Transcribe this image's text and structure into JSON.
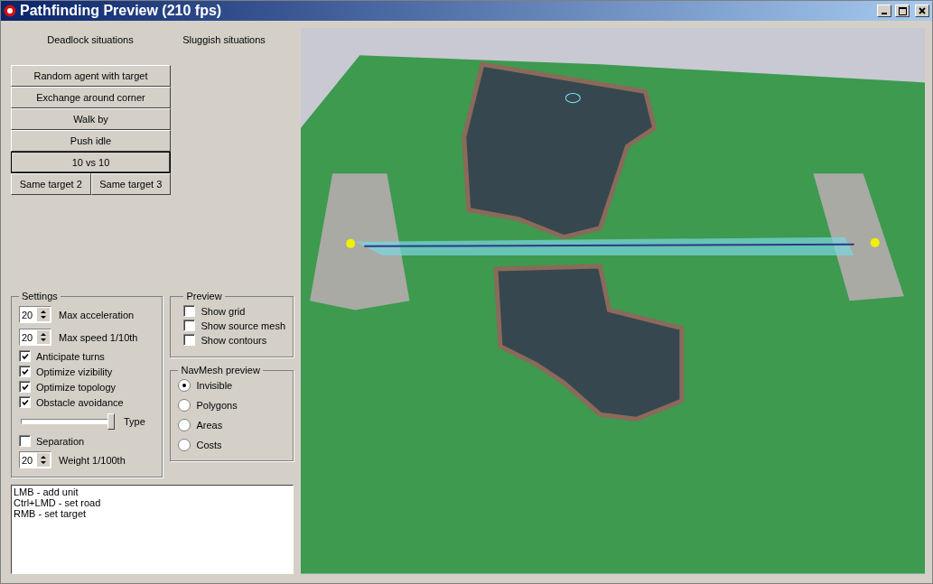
{
  "window": {
    "title": "Pathfinding Preview (210 fps)"
  },
  "columns": [
    {
      "heading": "Deadlock situations"
    },
    {
      "heading": "Sluggish situations"
    }
  ],
  "scenario_buttons": [
    {
      "label": "Random agent with target",
      "selected": false
    },
    {
      "label": "Exchange around corner",
      "selected": false
    },
    {
      "label": "Walk by",
      "selected": false
    },
    {
      "label": "Push idle",
      "selected": false
    },
    {
      "label": "10 vs 10",
      "selected": true
    }
  ],
  "scenario_pair": [
    {
      "label": "Same target 2",
      "selected": false
    },
    {
      "label": "Same target 3",
      "selected": false
    }
  ],
  "settings": {
    "title": "Settings",
    "items": [
      {
        "kind": "spin",
        "value": "20",
        "label": "Max acceleration"
      },
      {
        "kind": "spin",
        "value": "20",
        "label": "Max speed 1/10th"
      },
      {
        "kind": "check",
        "label": "Anticipate turns",
        "checked": true
      },
      {
        "kind": "check",
        "label": "Optimize vizibility",
        "checked": true
      },
      {
        "kind": "check",
        "label": "Optimize topology",
        "checked": true
      },
      {
        "kind": "check",
        "label": "Obstacle avoidance",
        "checked": true
      },
      {
        "kind": "slider",
        "label": "Type",
        "level": 1
      },
      {
        "kind": "check",
        "label": "Separation",
        "checked": false
      },
      {
        "kind": "spin",
        "value": "20",
        "label": "Weight 1/100th"
      }
    ]
  },
  "preview": {
    "title": "Preview",
    "items": [
      {
        "label": "Show grid",
        "checked": false
      },
      {
        "label": "Show source mesh",
        "checked": false
      },
      {
        "label": "Show contours",
        "checked": false
      }
    ]
  },
  "navmesh_preview": {
    "title": "NavMesh preview",
    "options": [
      {
        "label": "Invisible",
        "selected": true
      },
      {
        "label": "Polygons",
        "selected": false
      },
      {
        "label": "Areas",
        "selected": false
      },
      {
        "label": "Costs",
        "selected": false
      }
    ]
  },
  "help_text": [
    "LMB - add unit",
    "Ctrl+LMD - set road",
    "RMB - set target"
  ]
}
